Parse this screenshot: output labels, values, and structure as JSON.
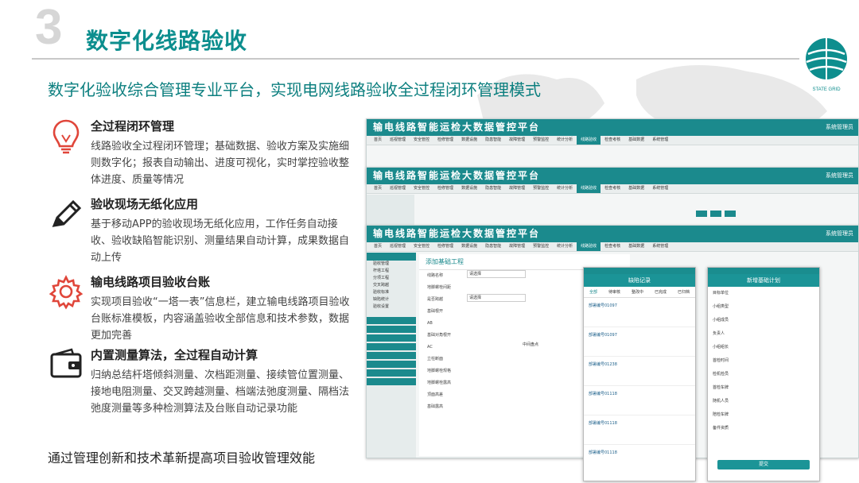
{
  "section_number": "3",
  "title": "数字化线路验收",
  "subtitle": "数字化验收综合管理专业平台，实现电网线路验收全过程闭环管理模式",
  "features": [
    {
      "icon": "lightbulb-icon",
      "title": "全过程闭环管理",
      "text": "线路验收全过程闭环管理；基础数据、验收方案及实施细则数字化；报表自动输出、进度可视化，实时掌控验收整体进度、质量等情况"
    },
    {
      "icon": "pencil-icon",
      "title": "验收现场无纸化应用",
      "text": "基于移动APP的验收现场无纸化应用，工作任务自动接收、验收缺陷智能识别、测量结果自动计算，成果数据自动上传"
    },
    {
      "icon": "gear-icon",
      "title": "输电线路项目验收台账",
      "text": "实现项目验收“一塔一表”信息栏，建立输电线路项目验收台账标准模板，内容涵盖验收全部信息和技术参数，数据更加完善"
    },
    {
      "icon": "wallet-icon",
      "title": "内置测量算法，全过程自动计算",
      "text": "归纳总结杆塔倾斜测量、次档距测量、接续管位置测量、接地电阻测量、交叉跨越测量、档端法弛度测量、隔档法弛度测量等多种检测算法及台账自动记录功能"
    }
  ],
  "bottom_text": "通过管理创新和技术革新提高项目验收管理效能",
  "platform_title": "输电线路智能运检大数据管控平台",
  "platform_user": "系统管理员",
  "menu_items": [
    "首页",
    "巡视管理",
    "安全管控",
    "检修管理",
    "数据设施",
    "隐患智能",
    "故障管理",
    "预警监控",
    "统计分析",
    "线路验收",
    "检查考核",
    "基础数据",
    "系统管理"
  ],
  "sidebar_items": [
    "验收管理",
    "杆塔工程",
    "分项工程",
    "交叉跨越",
    "验收标准",
    "缺陷统计",
    "验收设置"
  ],
  "form_title": "添加基础工程",
  "form_labels": [
    "线路名称",
    "地脚螺栓间距",
    "是否跨越",
    "基础根开",
    "AB",
    "基础对角根开",
    "AC",
    "立柱断面",
    "地脚螺栓规格",
    "地脚螺栓露高",
    "顶面高差",
    "基础露高"
  ],
  "form_select": "请选择",
  "mid_checkbox": "中间盘点",
  "phone1": {
    "title": "缺陷记录",
    "tabs": [
      "全部",
      "待审核",
      "整改中",
      "已完成",
      "已归档"
    ],
    "items": [
      "部署编号01097",
      "部署编号01097",
      "部署编号01238",
      "部署编号01118",
      "部署编号01118",
      "部署编号01118"
    ]
  },
  "phone2": {
    "title": "新增基础计划",
    "fields": [
      "目标单位",
      "小组类型",
      "小组成员",
      "负责人",
      "小组组长",
      "首检时间",
      "检机检员",
      "首检车牌",
      "随机人员",
      "陪检车牌",
      "备件资质"
    ],
    "submit": "提交"
  },
  "colors": {
    "teal": "#0c8e8e",
    "accent_red": "#e0463a"
  }
}
